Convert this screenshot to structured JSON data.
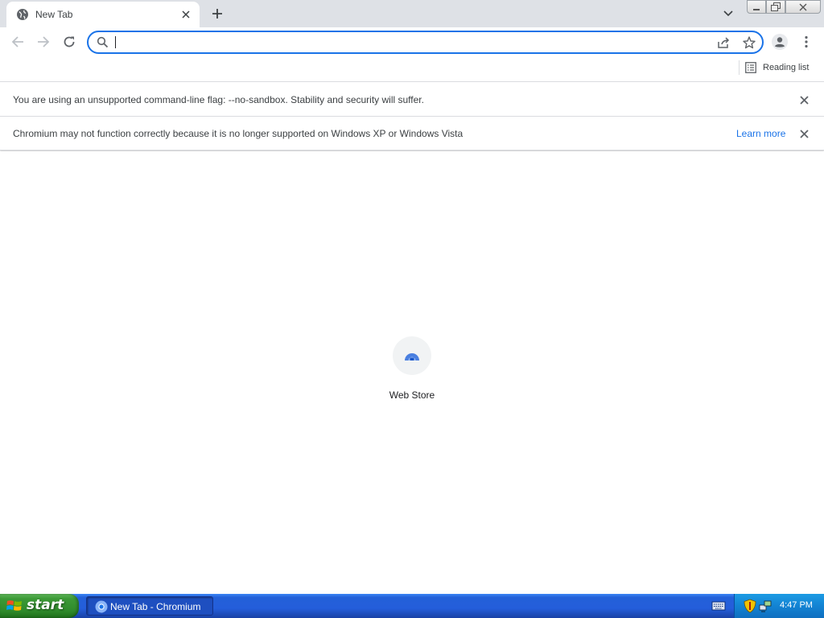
{
  "tab": {
    "title": "New Tab"
  },
  "omnibox": {
    "value": "",
    "placeholder": ""
  },
  "bookmarks": {
    "reading_list": "Reading list"
  },
  "infobars": [
    {
      "message": "You are using an unsupported command-line flag: --no-sandbox. Stability and security will suffer.",
      "link": ""
    },
    {
      "message": "Chromium may not function correctly because it is no longer supported on Windows XP or Windows Vista",
      "link": "Learn more"
    }
  ],
  "shortcuts": [
    {
      "label": "Web Store",
      "icon": "web-store-icon"
    }
  ],
  "taskbar": {
    "start_label": "start",
    "window_label": "New Tab - Chromium",
    "clock": "4:47 PM"
  },
  "colors": {
    "accent": "#1a73e8",
    "tabstrip": "#dee1e6",
    "taskbar": "#245edb",
    "start": "#3c9a36"
  }
}
